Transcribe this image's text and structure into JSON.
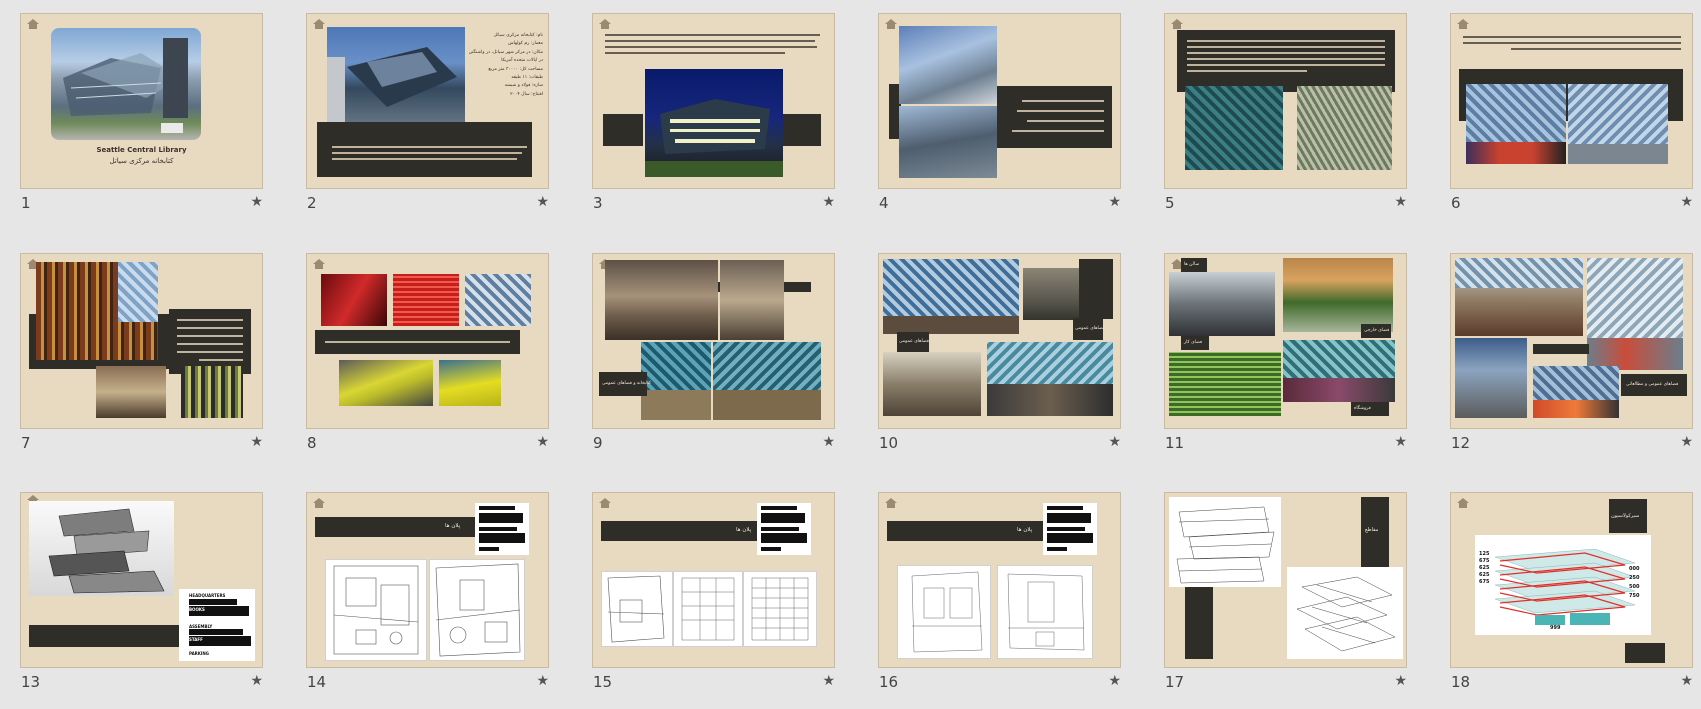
{
  "slides": [
    {
      "num": "1",
      "title": "Seattle Central Library",
      "subtitle": "کتابخانه مرکزی سیاتل"
    },
    {
      "num": "2",
      "info_lines": [
        "نام: کتابخانه مرکزی سیاتل",
        "معمار: رم کولهاس",
        "مکان: در مرکز شهر سیاتل، در واشنگتن",
        "در ایالات متحده آمریکا",
        "مساحت کل: ۳۰۰۰۰ متر مربع",
        "طبقات: ۱۱ طبقه",
        "سازه: فولاد و شیشه",
        "افتتاح: سال ۲۰۰۴"
      ]
    },
    {
      "num": "3"
    },
    {
      "num": "4"
    },
    {
      "num": "5"
    },
    {
      "num": "6"
    },
    {
      "num": "7"
    },
    {
      "num": "8"
    },
    {
      "num": "9",
      "caption": "کتابخانه و فضاهای عمومی"
    },
    {
      "num": "10",
      "caption_a": "فضاهای عمومی",
      "caption_b": "فضاهای عمومی"
    },
    {
      "num": "11",
      "cap1": "سالن ها",
      "cap2": "فضای کار",
      "cap3": "فضای خارجی",
      "cap4": "فروشگاه"
    },
    {
      "num": "12",
      "caption": "فضاهای عمومی و مطالعاتی"
    },
    {
      "num": "13",
      "legend": [
        "HEADQUARTERS",
        "BOOKS",
        "ASSEMBLY",
        "STAFF",
        "PARKING"
      ]
    },
    {
      "num": "14",
      "title": "پلان ها",
      "legend": [
        "HEADQUARTERS",
        "BOOKS",
        "ASSEMBLY",
        "STAFF",
        "PARKING"
      ]
    },
    {
      "num": "15",
      "title": "پلان ها",
      "legend": [
        "HEADQUARTERS",
        "BOOKS",
        "ASSEMBLY",
        "STAFF",
        "PARKING"
      ]
    },
    {
      "num": "16",
      "title": "پلان ها",
      "legend": [
        "HEADQUARTERS",
        "BOOKS",
        "ASSEMBLY",
        "STAFF",
        "PARKING"
      ]
    },
    {
      "num": "17",
      "title": "مقاطع"
    },
    {
      "num": "18",
      "title": "سیرکولاسیون",
      "levels": [
        "125",
        "675",
        "625",
        "625",
        "675"
      ],
      "levels_r": [
        "000",
        "250",
        "500",
        "750"
      ],
      "bottom": "999"
    }
  ],
  "colors": {
    "page_bg": "#e6e6e6",
    "slide_bg": "#e8d9c1",
    "dark_panel": "#2f2d28",
    "icons": "home-icon, star-icon"
  }
}
